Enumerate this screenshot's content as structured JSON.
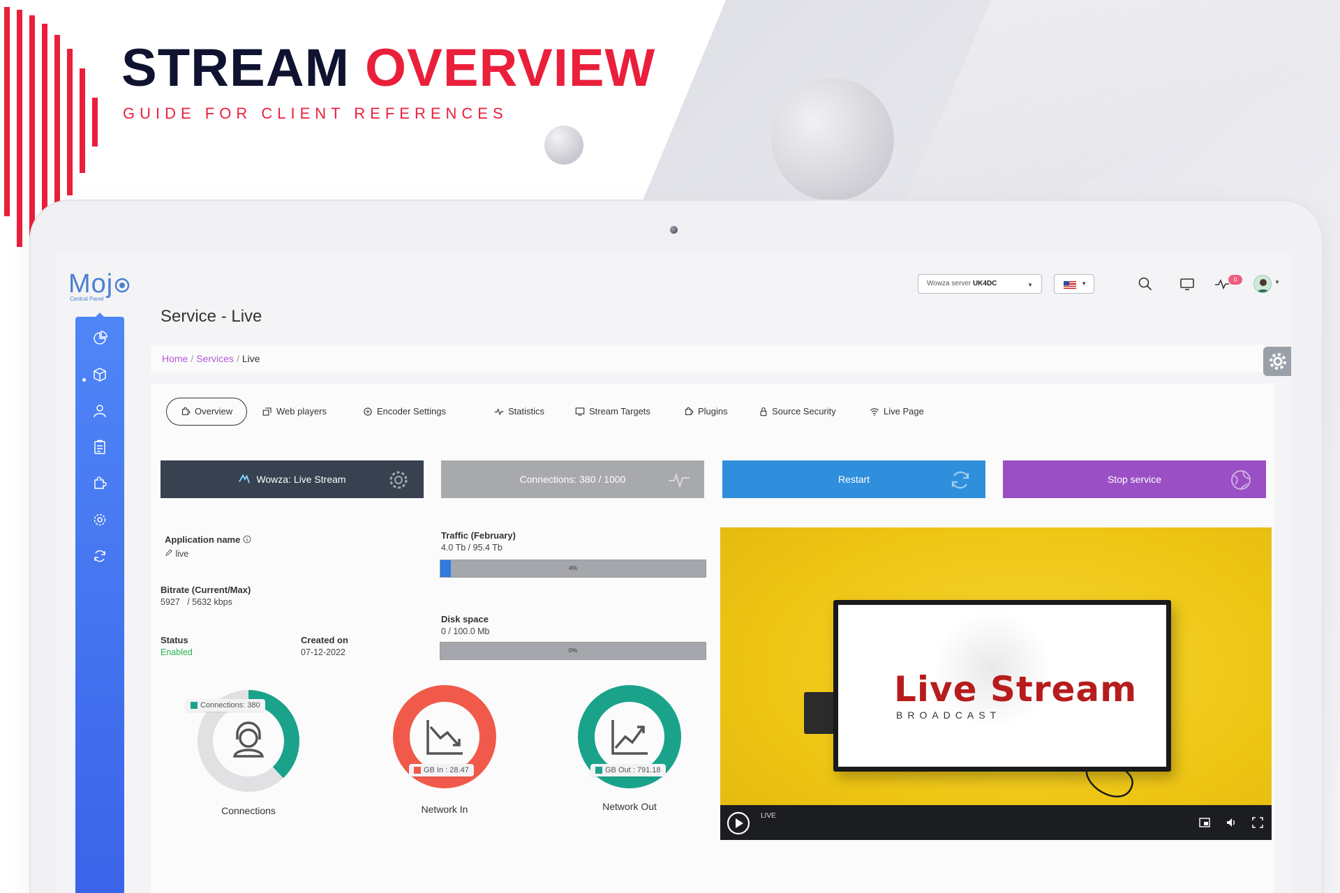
{
  "banner": {
    "title_main": "STREAM",
    "title_accent": "OVERVIEW",
    "subtitle": "GUIDE FOR CLIENT REFERENCES"
  },
  "app": {
    "logo_text": "Moj",
    "logo_sub": "Central Panel"
  },
  "topbar": {
    "server_prefix": "Wowza server",
    "server_value": "UK4DC",
    "notifications_count": "0",
    "icons": [
      "search-icon",
      "monitor-icon",
      "activity-icon",
      "avatar"
    ]
  },
  "sidebar": {
    "items": [
      "pie-chart-icon",
      "cube-icon",
      "user-icon",
      "clipboard-icon",
      "puzzle-icon",
      "settings-icon",
      "refresh-icon"
    ],
    "active_index": 1
  },
  "page": {
    "title": "Service - Live",
    "breadcrumb": {
      "home": "Home",
      "services": "Services",
      "current": "Live"
    }
  },
  "tabs": [
    {
      "label": "Overview",
      "icon": "puzzle-icon"
    },
    {
      "label": "Web players",
      "icon": "players-icon"
    },
    {
      "label": "Encoder Settings",
      "icon": "encoder-icon"
    },
    {
      "label": "Statistics",
      "icon": "pulse-icon"
    },
    {
      "label": "Stream Targets",
      "icon": "monitor-icon"
    },
    {
      "label": "Plugins",
      "icon": "puzzle-icon"
    },
    {
      "label": "Source Security",
      "icon": "lock-icon"
    },
    {
      "label": "Live Page",
      "icon": "wifi-icon"
    }
  ],
  "actions": {
    "wowza": "Wowza: Live Stream",
    "connections": "Connections: 380 / 1000",
    "restart": "Restart",
    "stop": "Stop service"
  },
  "info": {
    "app_name_label": "Application name",
    "app_name_value": "live",
    "bitrate_label": "Bitrate (Current/Max)",
    "bitrate_value": "5927   / 5632 kbps",
    "status_label": "Status",
    "status_value": "Enabled",
    "created_label": "Created on",
    "created_value": "07-12-2022"
  },
  "usage": {
    "traffic_label": "Traffic (February)",
    "traffic_value": "4.0 Tb / 95.4 Tb",
    "traffic_percent_text": "4%",
    "traffic_percent": 4,
    "disk_label": "Disk space",
    "disk_value": "0 / 100.0 Mb",
    "disk_percent_text": "0%",
    "disk_percent": 0
  },
  "gauges": {
    "connections": {
      "label": "Connections",
      "chip": "Connections: 380",
      "fraction": 0.38,
      "color": "#1aa38a"
    },
    "network_in": {
      "label": "Network In",
      "chip": "GB In : 28.47",
      "color": "#f15a4a"
    },
    "network_out": {
      "label": "Network Out",
      "chip": "GB Out : 791.18",
      "color": "#1aa38a"
    }
  },
  "video": {
    "headline": "Live Stream",
    "subline": "BROADCAST",
    "live_tag": "LIVE"
  },
  "colors": {
    "brand_red": "#ea1f3b",
    "sidebar_blue": "#4f86f7",
    "wowza_btn": "#37414f",
    "connections_btn": "#a8a9ad",
    "restart_btn": "#2f8fdc",
    "stop_btn": "#9b4fc4",
    "link_purple": "#b45ad6",
    "status_green": "#2bb24c"
  }
}
